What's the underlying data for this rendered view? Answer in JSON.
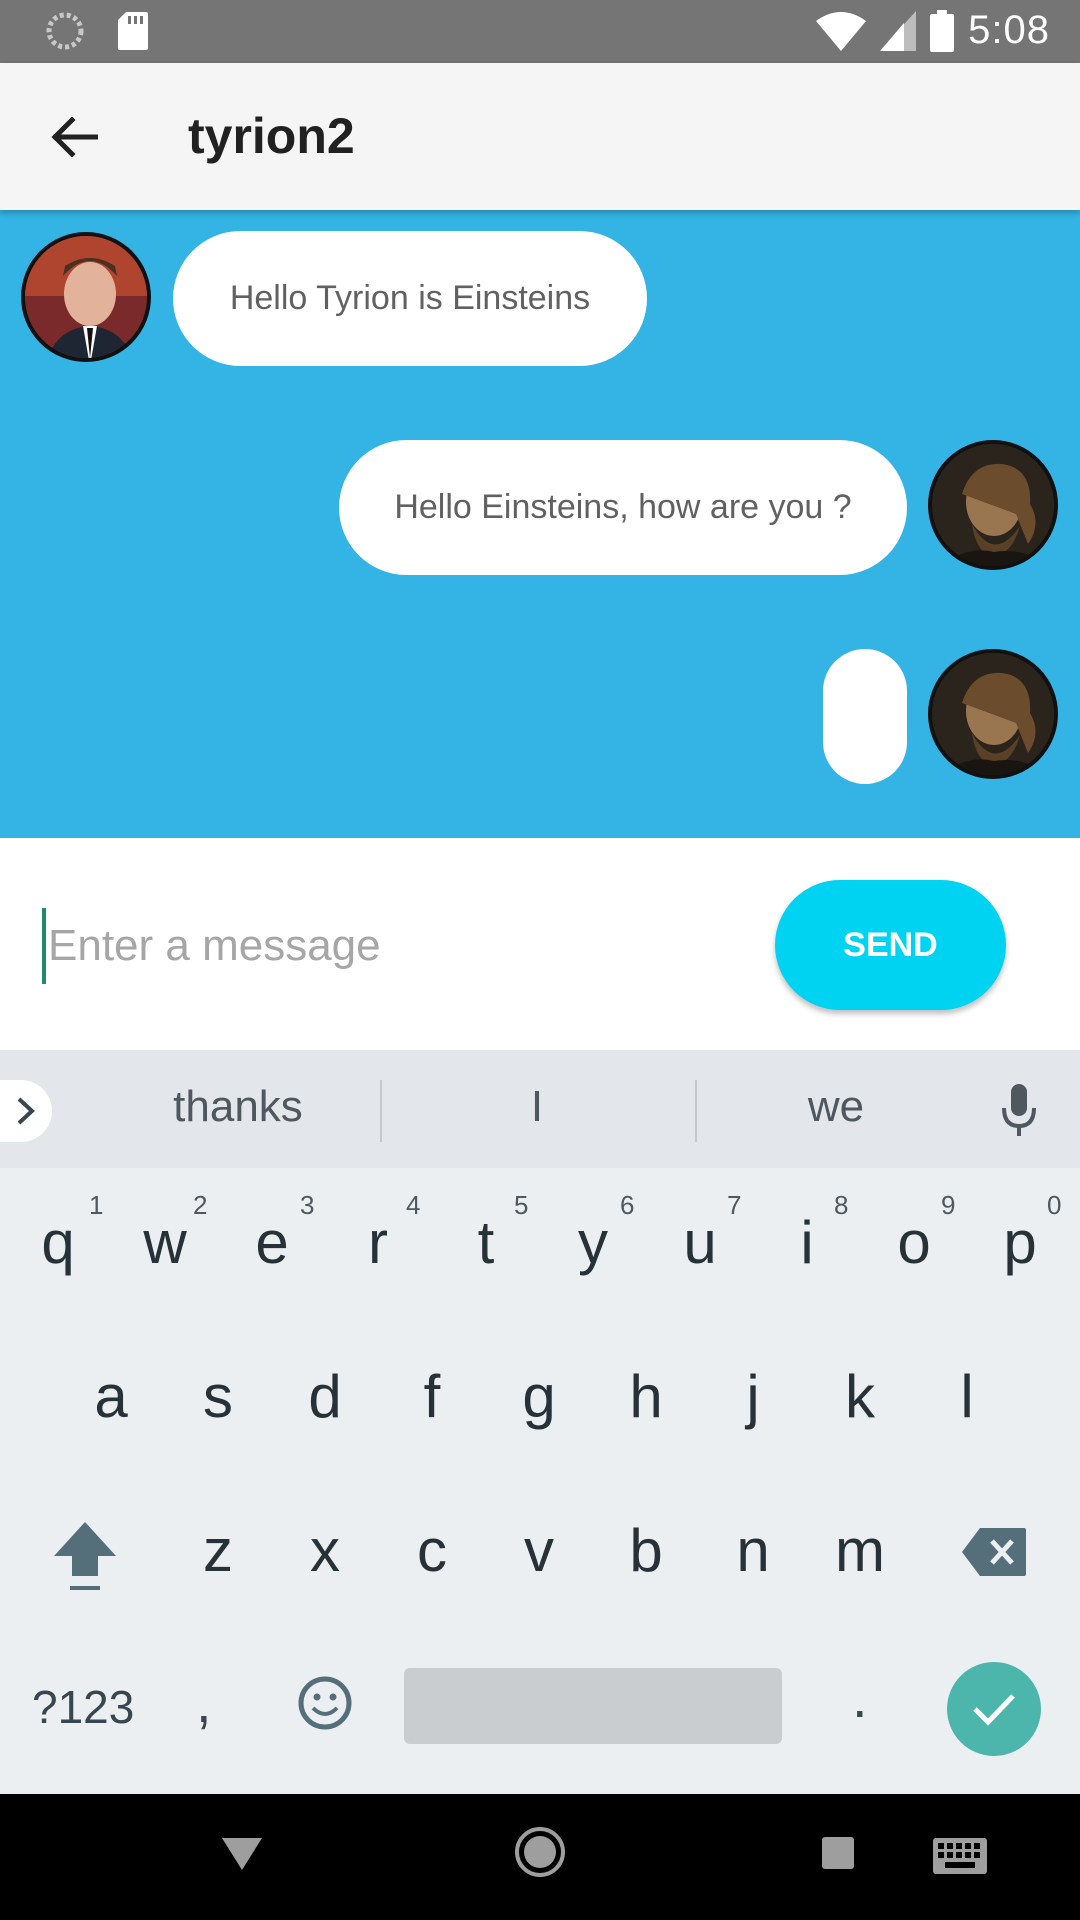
{
  "status_bar": {
    "time": "5:08",
    "icons": [
      "loading-icon",
      "sd-card-icon",
      "wifi-icon",
      "signal-icon",
      "battery-icon"
    ]
  },
  "app_bar": {
    "title": "tyrion2",
    "back_icon": "arrow-back-icon"
  },
  "chat": {
    "background": "#34b4e5",
    "messages": [
      {
        "side": "left",
        "text": "Hello Tyrion is Einsteins",
        "avatar": "avatar"
      },
      {
        "side": "right",
        "text": "Hello Einsteins, how are you ?",
        "avatar": "avatar"
      },
      {
        "side": "right",
        "text": "",
        "avatar": "avatar"
      }
    ]
  },
  "composer": {
    "placeholder": "Enter a message",
    "value": "",
    "send_label": "SEND",
    "send_color": "#00d2f2"
  },
  "keyboard": {
    "suggestions": [
      "thanks",
      "I",
      "we"
    ],
    "row1": [
      "q",
      "w",
      "e",
      "r",
      "t",
      "y",
      "u",
      "i",
      "o",
      "p"
    ],
    "row1_hints": [
      "1",
      "2",
      "3",
      "4",
      "5",
      "6",
      "7",
      "8",
      "9",
      "0"
    ],
    "row2": [
      "a",
      "s",
      "d",
      "f",
      "g",
      "h",
      "j",
      "k",
      "l"
    ],
    "row3": [
      "z",
      "x",
      "c",
      "v",
      "b",
      "n",
      "m"
    ],
    "symbols_label": "?123",
    "comma": ",",
    "period": ".",
    "enter_color": "#4db6ac"
  },
  "nav_bar": {
    "icons": [
      "back-triangle-icon",
      "home-circle-icon",
      "recents-square-icon",
      "keyboard-icon"
    ]
  }
}
